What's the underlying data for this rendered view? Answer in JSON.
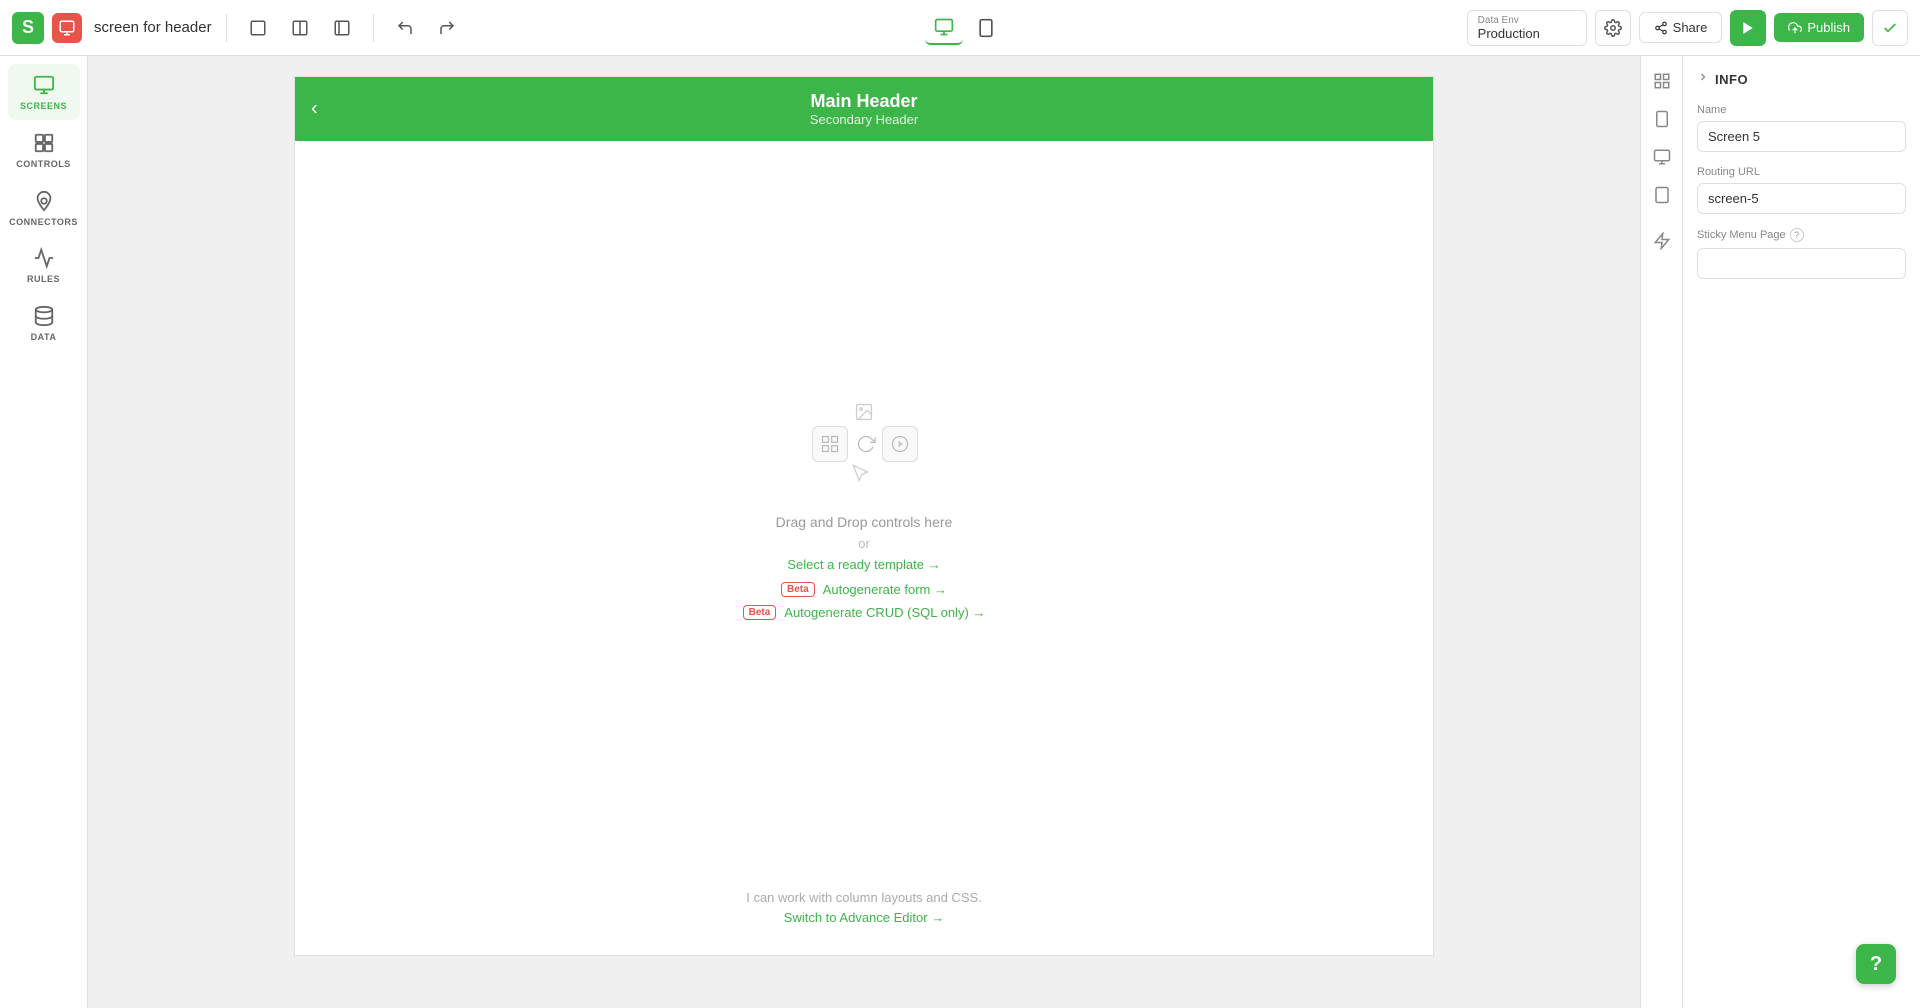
{
  "toolbar": {
    "logo_letter": "S",
    "app_icon_color": "#e8534a",
    "screen_title": "screen for header",
    "undo_label": "Undo",
    "redo_label": "Redo",
    "desktop_device": "Desktop",
    "mobile_device": "Mobile",
    "data_env_label": "Data Env",
    "data_env_value": "Production",
    "settings_label": "Settings",
    "share_label": "Share",
    "preview_label": "Preview",
    "publish_label": "Publish",
    "check_label": "Check",
    "layout_icons": [
      "full-layout",
      "half-layout",
      "side-layout"
    ]
  },
  "sidebar": {
    "items": [
      {
        "id": "screens",
        "label": "SCREENS"
      },
      {
        "id": "controls",
        "label": "CONTROLS"
      },
      {
        "id": "connectors",
        "label": "CONNECTORS"
      },
      {
        "id": "rules",
        "label": "RULES"
      },
      {
        "id": "data",
        "label": "DATA"
      }
    ]
  },
  "canvas": {
    "header": {
      "main_text": "Main Header",
      "secondary_text": "Secondary Header",
      "back_arrow": "‹"
    },
    "drop_zone": {
      "drag_drop_text": "Drag and Drop controls here",
      "or_text": "or",
      "template_link": "Select a ready template →",
      "autogenerate_form_label": "Autogenerate form →",
      "autogenerate_crud_label": "Autogenerate CRUD (SQL only) →",
      "beta_label": "Beta"
    },
    "bottom_info": {
      "text": "I can work with column layouts and CSS.",
      "advance_link": "Switch to Advance Editor →"
    }
  },
  "right_panel": {
    "section_label": "INFO",
    "name_label": "Name",
    "name_value": "Screen 5",
    "routing_url_label": "Routing URL",
    "routing_url_value": "screen-5",
    "sticky_menu_label": "Sticky Menu Page",
    "sticky_menu_placeholder": ""
  },
  "help_button_label": "?"
}
